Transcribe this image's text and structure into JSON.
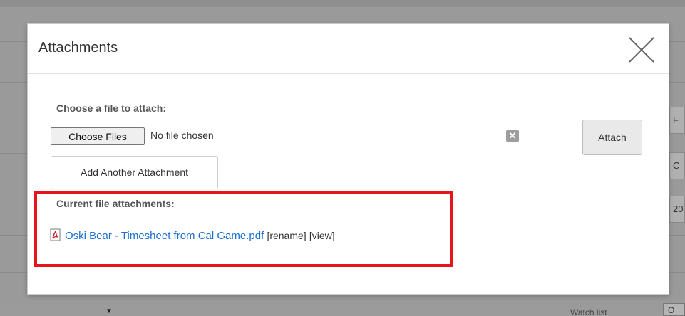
{
  "background": {
    "row_cells": [
      "F",
      "C",
      "20"
    ],
    "bottom_label": "Watch list",
    "bottom_box": "O",
    "arrow": "▼"
  },
  "modal": {
    "title": "Attachments",
    "close_icon": "close-icon",
    "choose_label": "Choose a file to attach:",
    "choose_button": "Choose Files",
    "no_file_text": "No file chosen",
    "clear_glyph": "✕",
    "attach_button": "Attach",
    "add_another_button": "Add Another Attachment",
    "current_label": "Current file attachments:",
    "attachments": [
      {
        "name": "Oski Bear - Timesheet from Cal Game.pdf",
        "rename_label": "[rename]",
        "view_label": "[view]",
        "icon": "pdf-icon"
      }
    ]
  },
  "colors": {
    "link": "#1a6fd1",
    "highlight": "#e8141c",
    "overlay": "#9a9a9a"
  }
}
